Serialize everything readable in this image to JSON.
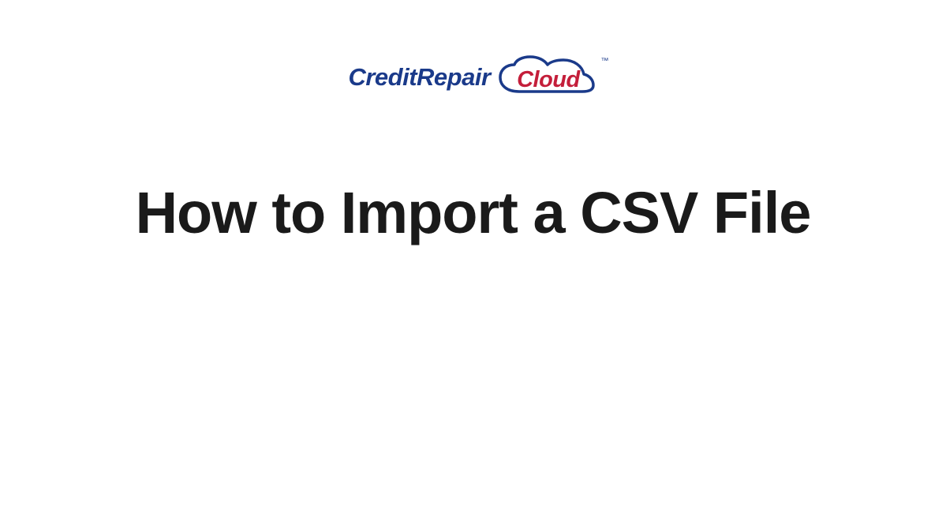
{
  "logo": {
    "text_left": "CreditRepair",
    "text_cloud": "Cloud",
    "trademark": "™",
    "colors": {
      "navy": "#1a3a8a",
      "red": "#c41e3a"
    }
  },
  "title": "How to Import a CSV File"
}
